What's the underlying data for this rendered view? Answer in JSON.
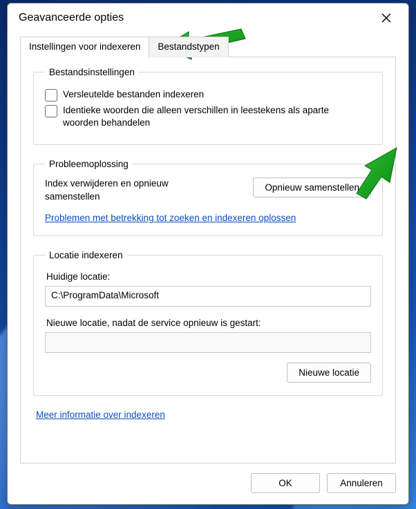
{
  "window": {
    "title": "Geavanceerde opties"
  },
  "tabs": {
    "index_settings": "Instellingen voor indexeren",
    "file_types": "Bestandstypen"
  },
  "file_settings": {
    "legend": "Bestandsinstellingen",
    "encrypt_label": "Versleutelde bestanden indexeren",
    "diacritics_label": "Identieke woorden die alleen verschillen in leestekens als aparte woorden behandelen"
  },
  "troubleshooting": {
    "legend": "Probleemoplossing",
    "rebuild_text": "Index verwijderen en opnieuw samenstellen",
    "rebuild_button": "Opnieuw samenstellen",
    "troubleshooter_link": "Problemen met betrekking tot zoeken en indexeren oplossen"
  },
  "index_location": {
    "legend": "Locatie indexeren",
    "current_label": "Huidige locatie:",
    "current_path": "C:\\ProgramData\\Microsoft",
    "new_label": "Nieuwe locatie, nadat de service opnieuw is gestart:",
    "new_path": "",
    "new_button": "Nieuwe locatie"
  },
  "more_info_link": "Meer informatie over indexeren",
  "buttons": {
    "ok": "OK",
    "cancel": "Annuleren"
  }
}
